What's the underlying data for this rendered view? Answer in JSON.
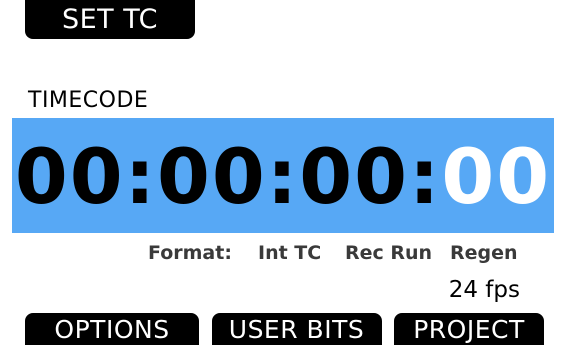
{
  "header": {
    "title": "SET TC"
  },
  "section": {
    "label": "TIMECODE"
  },
  "timecode": {
    "hours": "00",
    "sep1": ":",
    "minutes": "00",
    "sep2": ":",
    "seconds": "00",
    "sep3": ":",
    "frames": "00"
  },
  "info": {
    "format_label": "Format:",
    "source": "Int TC",
    "run_mode": "Rec Run",
    "mode": "Regen",
    "fps": "24 fps"
  },
  "softkeys": {
    "options": "OPTIONS",
    "user_bits": "USER BITS",
    "project": "PROJECT"
  },
  "colors": {
    "band": "#57a8f5",
    "selected_digit": "#ffffff",
    "button_bg": "#000000"
  }
}
